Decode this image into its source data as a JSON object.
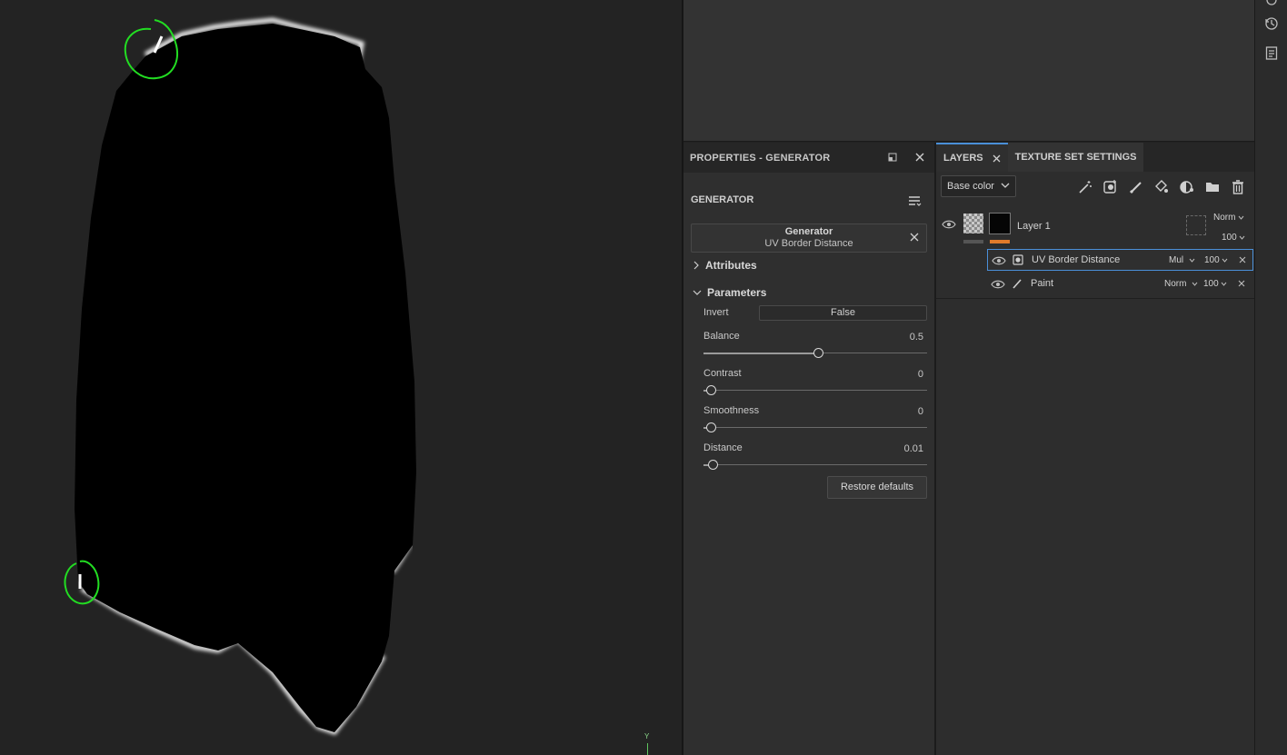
{
  "viewport": {
    "axis_label": "Y"
  },
  "properties_panel": {
    "title": "PROPERTIES - GENERATOR",
    "section_title": "GENERATOR",
    "generator_name": "Generator",
    "generator_type": "UV Border Distance",
    "attributes_label": "Attributes",
    "parameters_label": "Parameters",
    "params": {
      "invert_label": "Invert",
      "invert_value": "False",
      "balance_label": "Balance",
      "balance_value": "0.5",
      "contrast_label": "Contrast",
      "contrast_value": "0",
      "smoothness_label": "Smoothness",
      "smoothness_value": "0",
      "distance_label": "Distance",
      "distance_value": "0.01"
    },
    "slider_fractions": {
      "balance": 0.5,
      "contrast": 0,
      "smoothness": 0,
      "distance": 0.01
    },
    "restore_label": "Restore defaults"
  },
  "layers_panel": {
    "tab_layers": "LAYERS",
    "tab_texture": "TEXTURE SET SETTINGS",
    "channel": "Base color",
    "layer1": {
      "name": "Layer 1",
      "blend": "Norm",
      "opacity": "100"
    },
    "effects": [
      {
        "name": "UV Border Distance",
        "blend": "Mul",
        "opacity": "100"
      },
      {
        "name": "Paint",
        "blend": "Norm",
        "opacity": "100"
      }
    ]
  },
  "colors": {
    "accent": "#4a8fd8",
    "mask_orange": "#e07a2a",
    "annotation_green": "#22dd22"
  }
}
